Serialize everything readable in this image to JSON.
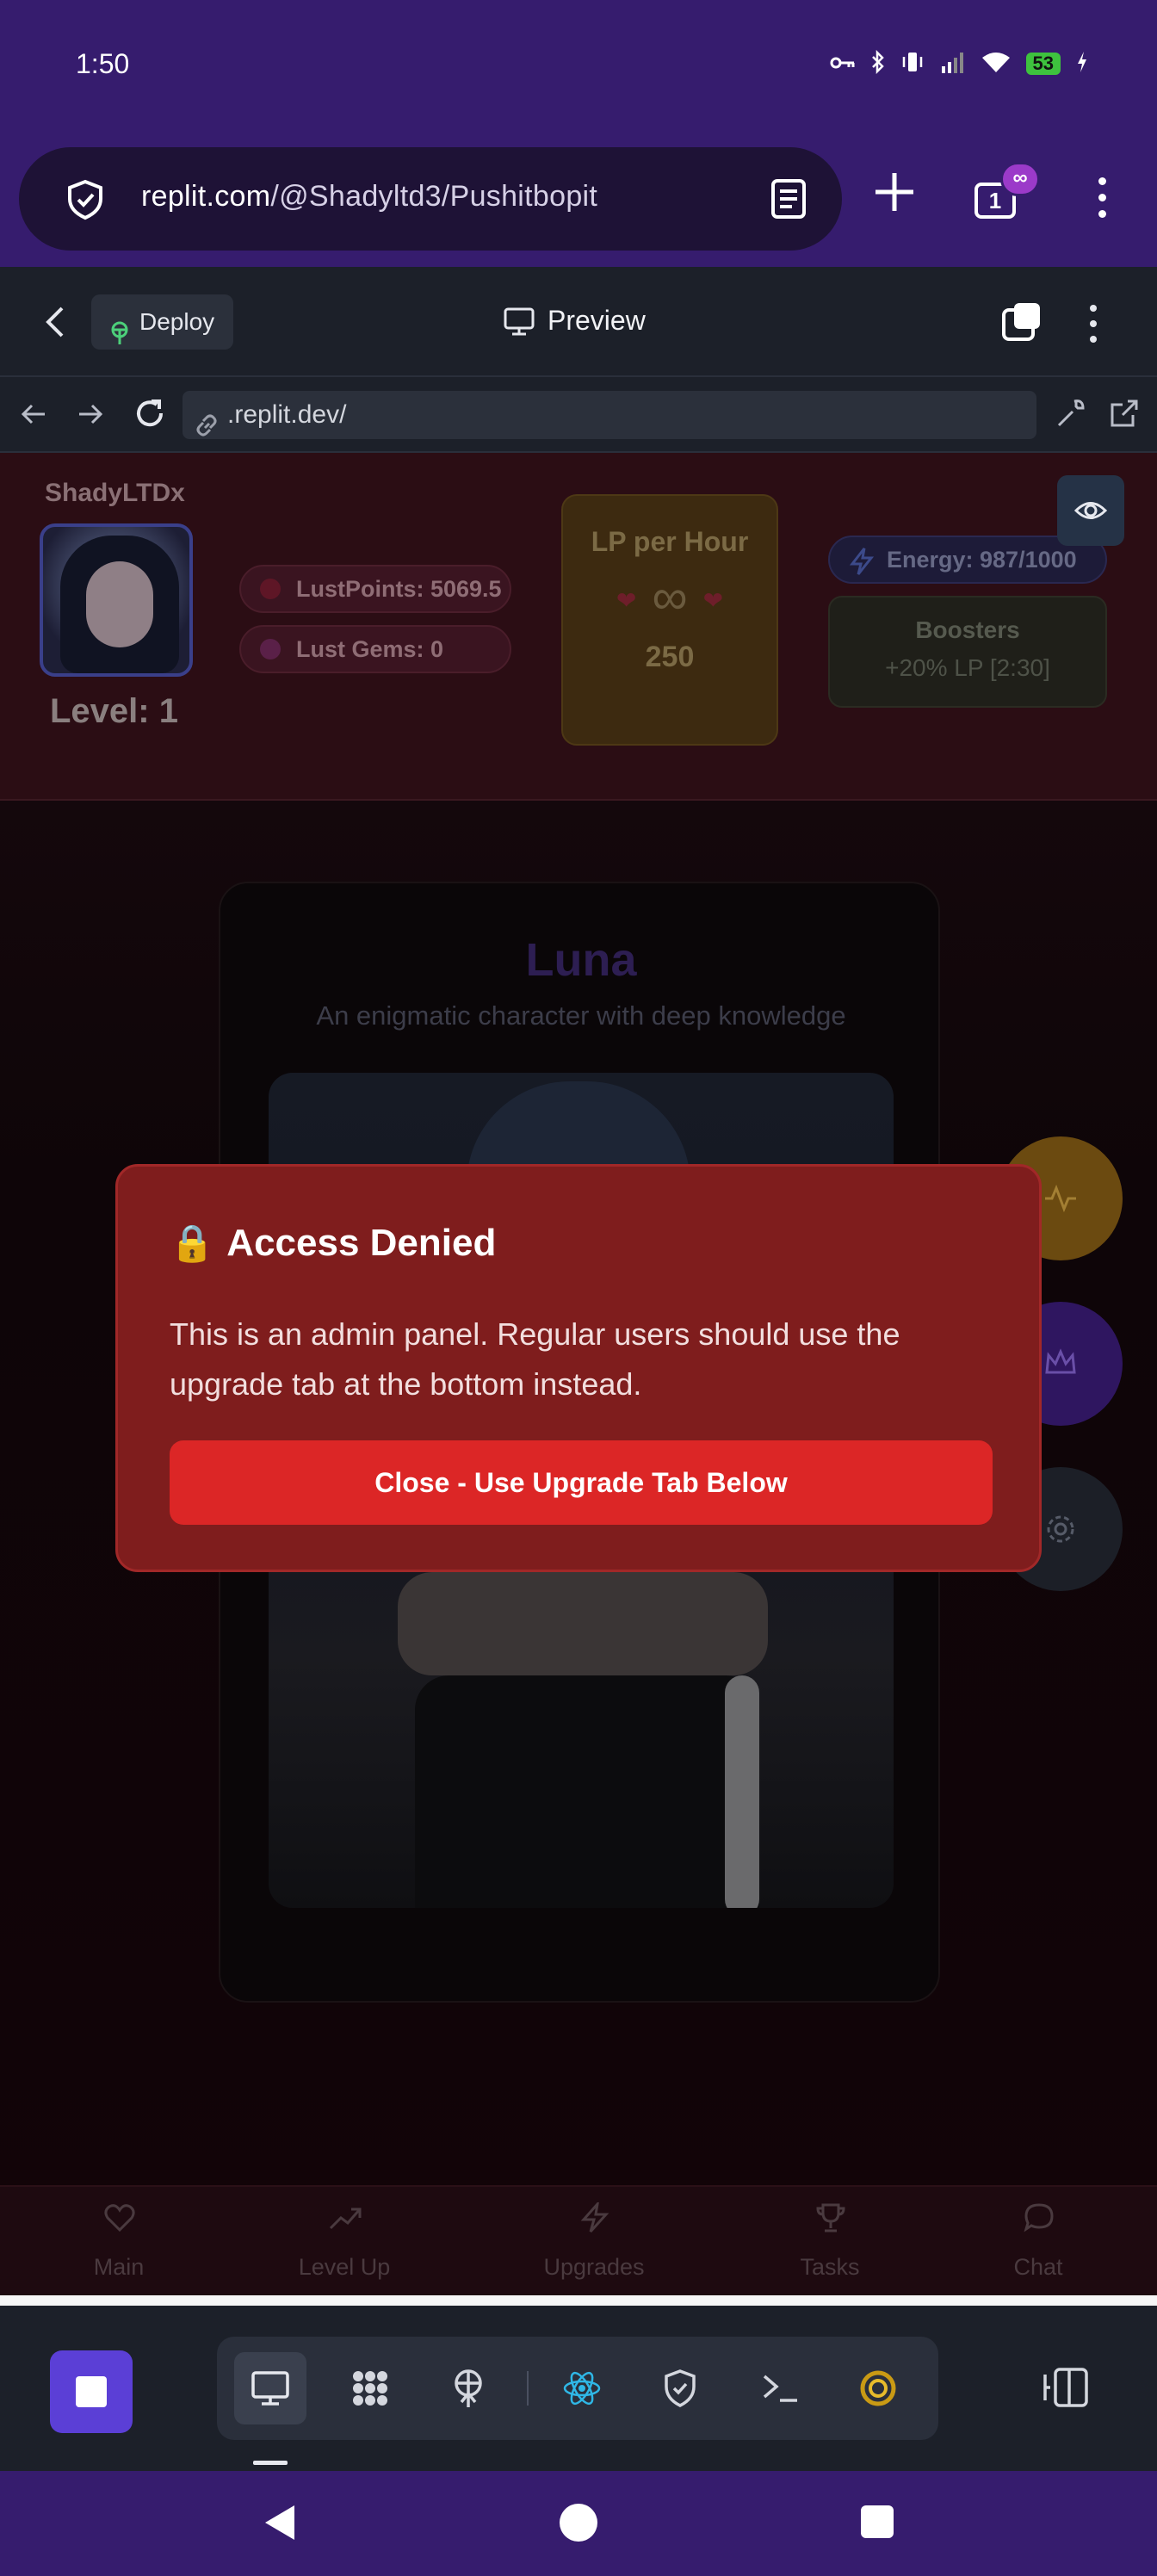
{
  "status_bar": {
    "time": "1:50",
    "battery": "53"
  },
  "browser": {
    "url_host": "replit.com",
    "url_path": "/@Shadyltd3/Pushitbopit",
    "tab_count": "1",
    "tab_badge": "∞"
  },
  "replit_header": {
    "deploy_label": "Deploy",
    "preview_label": "Preview"
  },
  "webview": {
    "url": ".replit.dev/"
  },
  "app": {
    "username": "ShadyLTDx",
    "level_text": "Level: 1",
    "lust_points": "LustPoints: 5069.5",
    "lust_gems": "Lust Gems: 0",
    "lp_per_hour_title": "LP per Hour",
    "lp_infinity": "∞",
    "lp_per_hour_value": "250",
    "energy": "Energy: 987/1000",
    "boosters_title": "Boosters",
    "boosters_value": "+20% LP [2:30]",
    "character": {
      "name": "Luna",
      "description": "An enigmatic character with deep knowledge"
    },
    "bottom_nav": [
      {
        "label": "Main",
        "icon": "heart-icon"
      },
      {
        "label": "Level Up",
        "icon": "trending-up-icon"
      },
      {
        "label": "Upgrades",
        "icon": "bolt-icon"
      },
      {
        "label": "Tasks",
        "icon": "trophy-icon"
      },
      {
        "label": "Chat",
        "icon": "chat-bubble-icon"
      }
    ],
    "fabs": [
      {
        "icon": "activity-icon",
        "color": "#6b4a10"
      },
      {
        "icon": "crown-icon",
        "color": "#2f1660"
      },
      {
        "icon": "gear-icon",
        "color": "#1c1f27"
      }
    ]
  },
  "modal": {
    "lock": "🔒",
    "title": "Access Denied",
    "message": "This is an admin panel. Regular users should use the upgrade tab at the bottom instead.",
    "close_label": "Close - Use Upgrade Tab Below"
  },
  "colors": {
    "system_bar": "#361c6e",
    "modal_bg": "#7f1d1d",
    "modal_button": "#dc2626",
    "dock_accent": "#5b3fd6"
  }
}
